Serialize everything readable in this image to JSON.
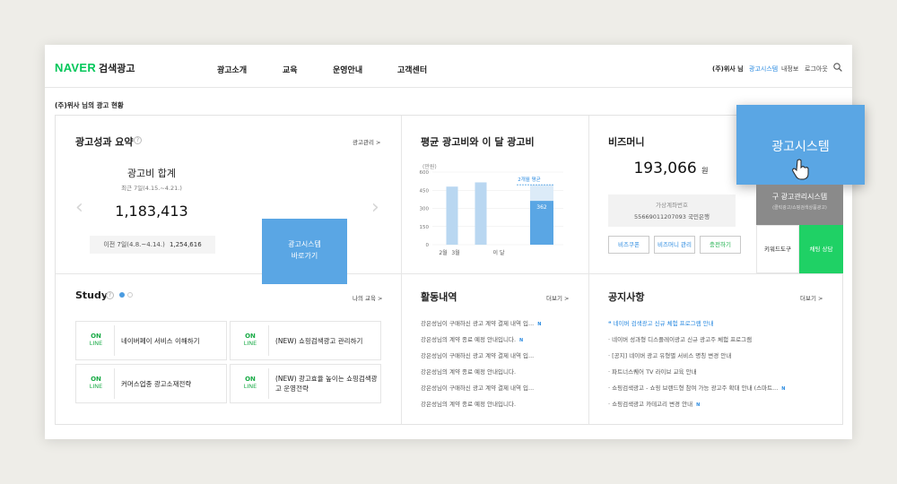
{
  "header": {
    "brand": "NAVER",
    "service": "검색광고",
    "nav": [
      "광고소개",
      "교육",
      "운영안내",
      "고객센터"
    ],
    "user": "(주)위사 님",
    "ad_system": "광고시스템",
    "my_info": "내정보",
    "logout": "로그아웃",
    "search_icon": "search-icon"
  },
  "caption": "(주)위사 님의 광고 현황",
  "performance": {
    "title": "광고성과 요약",
    "help": "?",
    "manage_link": "광고관리 >",
    "cost_label": "광고비 합계",
    "period": "최근 7일(4.15.~4.21.)",
    "total": "1,183,413",
    "prev_period": "이전 7일(4.8.~4.14.)",
    "prev_total": "1,254,616",
    "button_line1": "광고시스템",
    "button_line2": "바로가기",
    "prev_arrow": "‹",
    "next_arrow": "›"
  },
  "avg_chart": {
    "title": "평균 광고비와 이 달 광고비",
    "unit": "(만원)",
    "avg_label": "2개월 평균",
    "bar_label": "362",
    "chart_data": {
      "type": "bar",
      "categories": [
        "2월",
        "3월",
        "이 달"
      ],
      "values": [
        480,
        515,
        362
      ],
      "average": 495,
      "yticks": [
        "600",
        "450",
        "300",
        "150",
        "0"
      ],
      "ylim": [
        0,
        600
      ],
      "colors": {
        "past": "#b9d7f1",
        "current": "#5aa6e4",
        "avg_line": "#5aa6e4"
      }
    }
  },
  "bizmoney": {
    "title": "비즈머니",
    "amount": "193,066",
    "unit": "원",
    "account_label": "가상계좌번호",
    "account_number": "55669011207093 국민은행",
    "coupon": "비즈쿠폰",
    "manage": "비즈머니 관리",
    "charge": "충전하기"
  },
  "overlay": {
    "ad_system": "광고시스템",
    "old_system": "구 광고관리시스템",
    "old_sub": "(클릭광고/쇼핑검색상품광고)",
    "keyword_tool": "키워드도구",
    "consult": "채팅 상담"
  },
  "study": {
    "title": "Study",
    "help": "?",
    "my_edu": "나의 교육 >",
    "online": "ON",
    "line": "LINE",
    "cards": [
      "네이버페이 서비스 이해하기",
      "(NEW) 쇼핑검색광고 관리하기",
      "커머스업종 광고소재전략",
      "(NEW) 광고효율 높이는 쇼핑검색광고 운영전략"
    ]
  },
  "activity": {
    "title": "활동내역",
    "more": "더보기 >",
    "items": [
      "강은성님이 구매하신 광고 계약 결제 내역 입...",
      "강은성님의 계약 종료 예정 안내입니다.",
      "강은성님이 구매하신 광고 계약 결제 내역 입...",
      "강은성님의 계약 종료 예정 안내입니다.",
      "강은성님이 구매하신 광고 계약 결제 내역 입...",
      "강은성님의 계약 종료 예정 안내입니다."
    ]
  },
  "notice": {
    "title": "공지사항",
    "more": "더보기 >",
    "highlight": "네이버 검색광고 신규 체험 프로그램 안내",
    "items": [
      "네이버 성과형 디스플레이광고 신규 광고주 체험 프로그램",
      "[공지] 네이버 광고 유형별 서비스 명칭 변경 안내",
      "파트너스퀘어 TV 라이브 교육 안내",
      "쇼핑검색광고 - 쇼핑 브랜드형 참여 가능 광고주 확대 안내 (스마트...",
      "쇼핑검색광고 카테고리 변경 안내"
    ],
    "badge": "N"
  }
}
